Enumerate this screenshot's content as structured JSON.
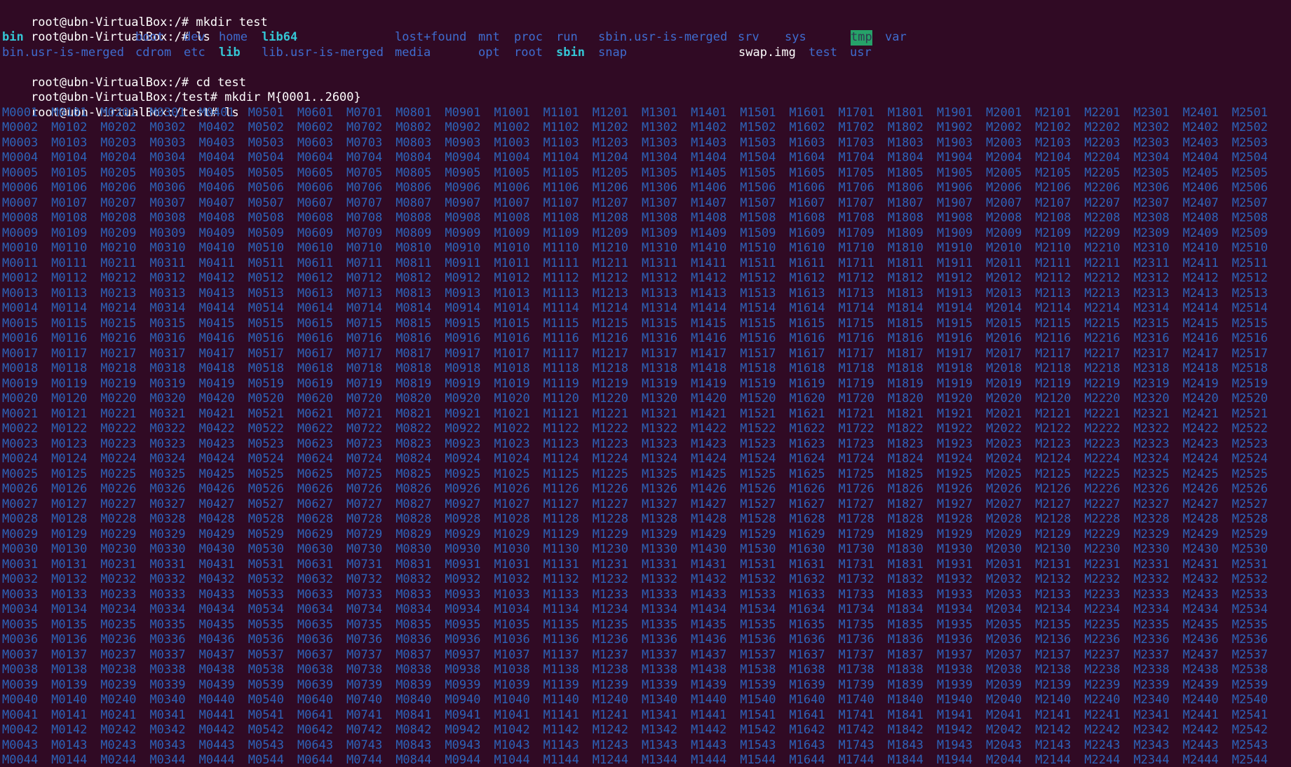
{
  "session": {
    "prompt_root": "root@ubn-VirtualBox:/# ",
    "prompt_test": "root@ubn-VirtualBox:/test# "
  },
  "lines": [
    {
      "prompt": "root@ubn-VirtualBox:/# ",
      "command": "mkdir test"
    },
    {
      "prompt": "root@ubn-VirtualBox:/# ",
      "command": "ls"
    },
    {
      "prompt": "root@ubn-VirtualBox:/# ",
      "command": "cd test"
    },
    {
      "prompt": "root@ubn-VirtualBox:/test# ",
      "command": "mkdir M{0001..2600}"
    },
    {
      "prompt": "root@ubn-VirtualBox:/test# ",
      "command": "ls"
    }
  ],
  "root_listing": {
    "row1": [
      {
        "name": "bin",
        "kind": "link"
      },
      {
        "name": "boot",
        "kind": "dir"
      },
      {
        "name": "dev",
        "kind": "dir"
      },
      {
        "name": "home",
        "kind": "dir"
      },
      {
        "name": "lib64",
        "kind": "link"
      },
      {
        "name": "lost+found",
        "kind": "dir"
      },
      {
        "name": "mnt",
        "kind": "dir"
      },
      {
        "name": "proc",
        "kind": "dir"
      },
      {
        "name": "run",
        "kind": "dir"
      },
      {
        "name": "sbin.usr-is-merged",
        "kind": "dir"
      },
      {
        "name": "srv",
        "kind": "dir"
      },
      {
        "name": "sys",
        "kind": "dir"
      },
      {
        "name": "tmp",
        "kind": "sticky"
      },
      {
        "name": "var",
        "kind": "dir"
      }
    ],
    "row2": [
      {
        "name": "bin.usr-is-merged",
        "kind": "dir"
      },
      {
        "name": "cdrom",
        "kind": "dir"
      },
      {
        "name": "etc",
        "kind": "dir"
      },
      {
        "name": "lib",
        "kind": "link"
      },
      {
        "name": "lib.usr-is-merged",
        "kind": "dir"
      },
      {
        "name": "media",
        "kind": "dir"
      },
      {
        "name": "opt",
        "kind": "dir"
      },
      {
        "name": "root",
        "kind": "dir"
      },
      {
        "name": "sbin",
        "kind": "link"
      },
      {
        "name": "snap",
        "kind": "dir"
      },
      {
        "name": "swap.img",
        "kind": "file"
      },
      {
        "name": "test",
        "kind": "dir"
      },
      {
        "name": "usr",
        "kind": "dir"
      }
    ]
  },
  "test_listing": {
    "prefix": "M",
    "column_start_values": [
      1,
      101,
      201,
      301,
      401,
      501,
      601,
      701,
      801,
      901,
      1001,
      1101,
      1201,
      1301,
      1401,
      1501,
      1601,
      1701,
      1801,
      1901,
      2001,
      2101,
      2201,
      2301,
      2401,
      2501
    ],
    "visible_rows": 44,
    "pad_width": 4
  },
  "colors": {
    "background": "#300a24",
    "text": "#ffffff",
    "directory": "#2d63b8",
    "symlink": "#34c7d6",
    "sticky_bg": "#26a269"
  }
}
